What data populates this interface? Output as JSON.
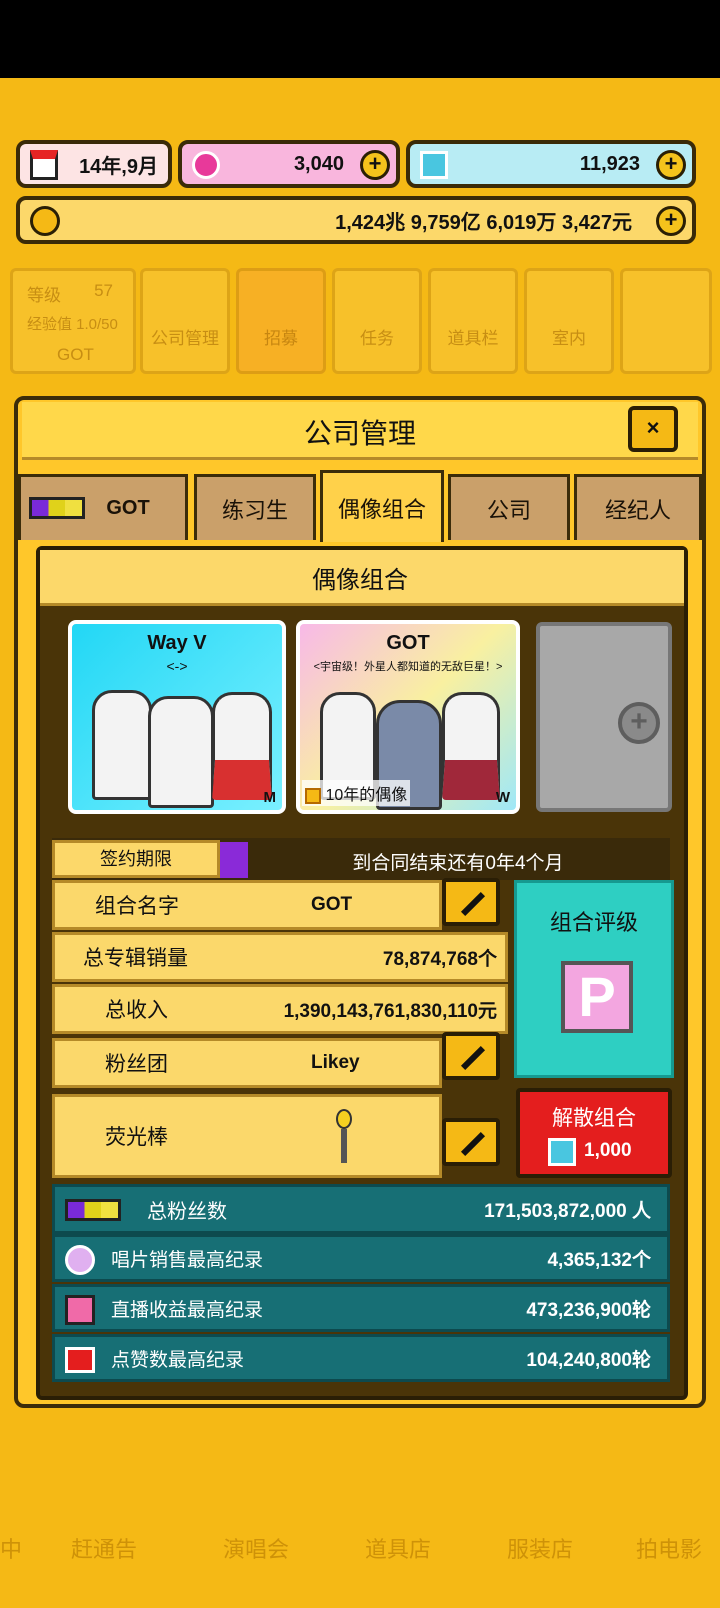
{
  "status": {
    "date": "14年,9月",
    "gems": "3,040",
    "diamonds": "11,923",
    "money": "1,424兆 9,759亿 6,019万 3,427元"
  },
  "nav": {
    "level_label": "等级",
    "level_value": "57",
    "exp": "经验值 1.0/50",
    "company": "GOT",
    "items": [
      "公司管理",
      "招募",
      "任务",
      "道具栏",
      "室内"
    ]
  },
  "dialog": {
    "title": "公司管理",
    "close": "×"
  },
  "tabs": [
    "GOT",
    "练习生",
    "偶像组合",
    "公司",
    "经纪人"
  ],
  "section_title": "偶像组合",
  "groups": [
    {
      "name": "Way V",
      "subtitle": "<->",
      "gender": "M"
    },
    {
      "name": "GOT",
      "subtitle": "<宇宙级！外星人都知道的无敌巨星！>",
      "gender": "W",
      "badge": "10年的偶像"
    }
  ],
  "contract": {
    "label": "签约期限",
    "value": "到合同结束还有0年4个月"
  },
  "info": {
    "name_label": "组合名字",
    "name_value": "GOT",
    "sales_label": "总专辑销量",
    "sales_value": "78,874,768个",
    "income_label": "总收入",
    "income_value": "1,390,143,761,830,110元",
    "fan_label": "粉丝团",
    "fan_value": "Likey",
    "stick_label": "荧光棒"
  },
  "rating": {
    "label": "组合评级",
    "value": "P"
  },
  "disband": {
    "label": "解散组合",
    "cost": "1,000"
  },
  "stats": [
    {
      "label": "总粉丝数",
      "value": "171,503,872,000 人"
    },
    {
      "label": "唱片销售最高纪录",
      "value": "4,365,132个"
    },
    {
      "label": "直播收益最高纪录",
      "value": "473,236,900轮"
    },
    {
      "label": "点赞数最高纪录",
      "value": "104,240,800轮"
    }
  ],
  "bottom_nav": [
    "中",
    "赶通告",
    "演唱会",
    "道具店",
    "服装店",
    "拍电影"
  ]
}
